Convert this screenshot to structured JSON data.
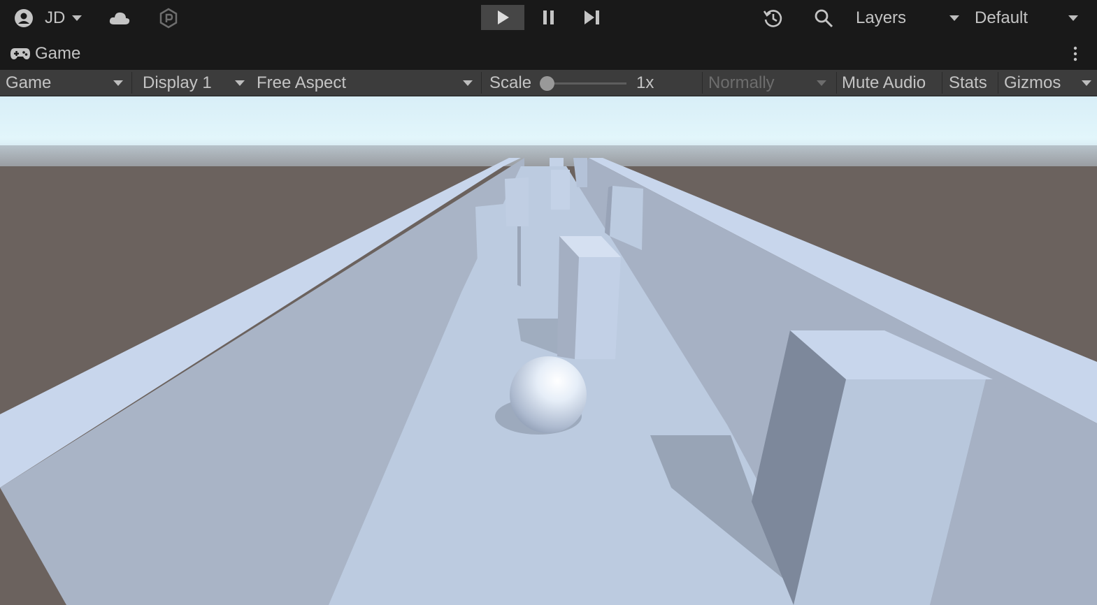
{
  "top_toolbar": {
    "account_label": "JD",
    "layers_label": "Layers",
    "layout_label": "Default"
  },
  "tab": {
    "title": "Game"
  },
  "game_controls": {
    "mode": "Game",
    "display": "Display 1",
    "aspect": "Free Aspect",
    "scale_label": "Scale",
    "scale_value": "1x",
    "scale_slider_fraction": 0,
    "play_focus": "Normally",
    "mute_audio": "Mute Audio",
    "stats": "Stats",
    "gizmos": "Gizmos"
  },
  "colors": {
    "toolbar_bg": "#191919",
    "control_bar_bg": "#3c3c3c",
    "sky_top": "#ddf3fb",
    "ground": "#6b625e",
    "track": "#c8d6ec"
  },
  "icons": [
    "account-icon",
    "cloud-icon",
    "package-icon",
    "play-icon",
    "pause-icon",
    "step-icon",
    "history-icon",
    "search-icon",
    "gamepad-icon",
    "kebab-menu-icon"
  ]
}
